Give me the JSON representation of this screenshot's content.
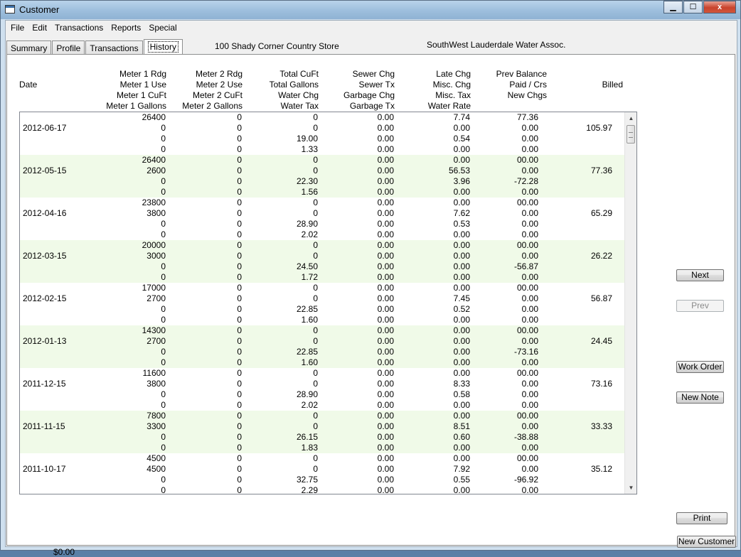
{
  "window": {
    "title": "Customer",
    "min_glyph": "▁",
    "max_glyph": "☐",
    "close_glyph": "x"
  },
  "menu": [
    "File",
    "Edit",
    "Transactions",
    "Reports",
    "Special"
  ],
  "tabs": [
    {
      "label": "Summary",
      "active": false
    },
    {
      "label": "Profile",
      "active": false
    },
    {
      "label": "Transactions",
      "active": false
    },
    {
      "label": "History",
      "active": true
    }
  ],
  "customer": {
    "name": "100 Shady Corner Country Store",
    "organization": "SouthWest Lauderdale Water Assoc."
  },
  "table": {
    "date_header": "Date",
    "billed_header": "Billed",
    "column_headers": [
      [
        "Meter 1 Rdg",
        "Meter 1 Use",
        "Meter 1 CuFt",
        "Meter 1 Gallons"
      ],
      [
        "Meter 2 Rdg",
        "Meter 2 Use",
        "Meter 2 CuFt",
        "Meter 2 Gallons"
      ],
      [
        "Total CuFt",
        "Total Gallons",
        "Water Chg",
        "Water Tax"
      ],
      [
        "Sewer Chg",
        "Sewer Tx",
        "Garbage Chg",
        "Garbage Tx"
      ],
      [
        "Late Chg",
        "Misc. Chg",
        "Misc. Tax",
        "Water Rate"
      ],
      [
        "Prev Balance",
        "Paid / Crs",
        "New Chgs"
      ]
    ],
    "records": [
      {
        "date": "2012-06-17",
        "billed": "105.97",
        "cols": [
          [
            "26400",
            "0",
            "0",
            "0"
          ],
          [
            "0",
            "0",
            "0",
            "0"
          ],
          [
            "0",
            "0",
            "19.00",
            "1.33"
          ],
          [
            "0.00",
            "0.00",
            "0.00",
            "0.00"
          ],
          [
            "7.74",
            "0.00",
            "0.54",
            "0.00"
          ],
          [
            "77.36",
            "0.00",
            "0.00",
            "0.00"
          ]
        ]
      },
      {
        "date": "2012-05-15",
        "billed": "77.36",
        "cols": [
          [
            "26400",
            "2600",
            "0",
            "0"
          ],
          [
            "0",
            "0",
            "0",
            "0"
          ],
          [
            "0",
            "0",
            "22.30",
            "1.56"
          ],
          [
            "0.00",
            "0.00",
            "0.00",
            "0.00"
          ],
          [
            "0.00",
            "56.53",
            "3.96",
            "0.00"
          ],
          [
            "00.00",
            "0.00",
            "-72.28",
            "0.00"
          ]
        ]
      },
      {
        "date": "2012-04-16",
        "billed": "65.29",
        "cols": [
          [
            "23800",
            "3800",
            "0",
            "0"
          ],
          [
            "0",
            "0",
            "0",
            "0"
          ],
          [
            "0",
            "0",
            "28.90",
            "2.02"
          ],
          [
            "0.00",
            "0.00",
            "0.00",
            "0.00"
          ],
          [
            "0.00",
            "7.62",
            "0.53",
            "0.00"
          ],
          [
            "00.00",
            "0.00",
            "0.00",
            "0.00"
          ]
        ]
      },
      {
        "date": "2012-03-15",
        "billed": "26.22",
        "cols": [
          [
            "20000",
            "3000",
            "0",
            "0"
          ],
          [
            "0",
            "0",
            "0",
            "0"
          ],
          [
            "0",
            "0",
            "24.50",
            "1.72"
          ],
          [
            "0.00",
            "0.00",
            "0.00",
            "0.00"
          ],
          [
            "0.00",
            "0.00",
            "0.00",
            "0.00"
          ],
          [
            "00.00",
            "0.00",
            "-56.87",
            "0.00"
          ]
        ]
      },
      {
        "date": "2012-02-15",
        "billed": "56.87",
        "cols": [
          [
            "17000",
            "2700",
            "0",
            "0"
          ],
          [
            "0",
            "0",
            "0",
            "0"
          ],
          [
            "0",
            "0",
            "22.85",
            "1.60"
          ],
          [
            "0.00",
            "0.00",
            "0.00",
            "0.00"
          ],
          [
            "0.00",
            "7.45",
            "0.52",
            "0.00"
          ],
          [
            "00.00",
            "0.00",
            "0.00",
            "0.00"
          ]
        ]
      },
      {
        "date": "2012-01-13",
        "billed": "24.45",
        "cols": [
          [
            "14300",
            "2700",
            "0",
            "0"
          ],
          [
            "0",
            "0",
            "0",
            "0"
          ],
          [
            "0",
            "0",
            "22.85",
            "1.60"
          ],
          [
            "0.00",
            "0.00",
            "0.00",
            "0.00"
          ],
          [
            "0.00",
            "0.00",
            "0.00",
            "0.00"
          ],
          [
            "00.00",
            "0.00",
            "-73.16",
            "0.00"
          ]
        ]
      },
      {
        "date": "2011-12-15",
        "billed": "73.16",
        "cols": [
          [
            "11600",
            "3800",
            "0",
            "0"
          ],
          [
            "0",
            "0",
            "0",
            "0"
          ],
          [
            "0",
            "0",
            "28.90",
            "2.02"
          ],
          [
            "0.00",
            "0.00",
            "0.00",
            "0.00"
          ],
          [
            "0.00",
            "8.33",
            "0.58",
            "0.00"
          ],
          [
            "00.00",
            "0.00",
            "0.00",
            "0.00"
          ]
        ]
      },
      {
        "date": "2011-11-15",
        "billed": "33.33",
        "cols": [
          [
            "7800",
            "3300",
            "0",
            "0"
          ],
          [
            "0",
            "0",
            "0",
            "0"
          ],
          [
            "0",
            "0",
            "26.15",
            "1.83"
          ],
          [
            "0.00",
            "0.00",
            "0.00",
            "0.00"
          ],
          [
            "0.00",
            "8.51",
            "0.60",
            "0.00"
          ],
          [
            "00.00",
            "0.00",
            "-38.88",
            "0.00"
          ]
        ]
      },
      {
        "date": "2011-10-17",
        "billed": "35.12",
        "cols": [
          [
            "4500",
            "4500",
            "0",
            "0"
          ],
          [
            "0",
            "0",
            "0",
            "0"
          ],
          [
            "0",
            "0",
            "32.75",
            "2.29"
          ],
          [
            "0.00",
            "0.00",
            "0.00",
            "0.00"
          ],
          [
            "0.00",
            "7.92",
            "0.55",
            "0.00"
          ],
          [
            "00.00",
            "0.00",
            "-96.92",
            "0.00"
          ]
        ]
      }
    ]
  },
  "buttons": {
    "next": "Next",
    "prev": "Prev",
    "work_order": "Work Order",
    "new_note": "New Note",
    "print": "Print",
    "new_customer": "New Customer"
  },
  "scroll": {
    "up_glyph": "▲",
    "down_glyph": "▼"
  },
  "balance": "$0.00",
  "colors": {
    "alt_row": "#f0fae8",
    "window_frame": "#cfe0ef"
  }
}
